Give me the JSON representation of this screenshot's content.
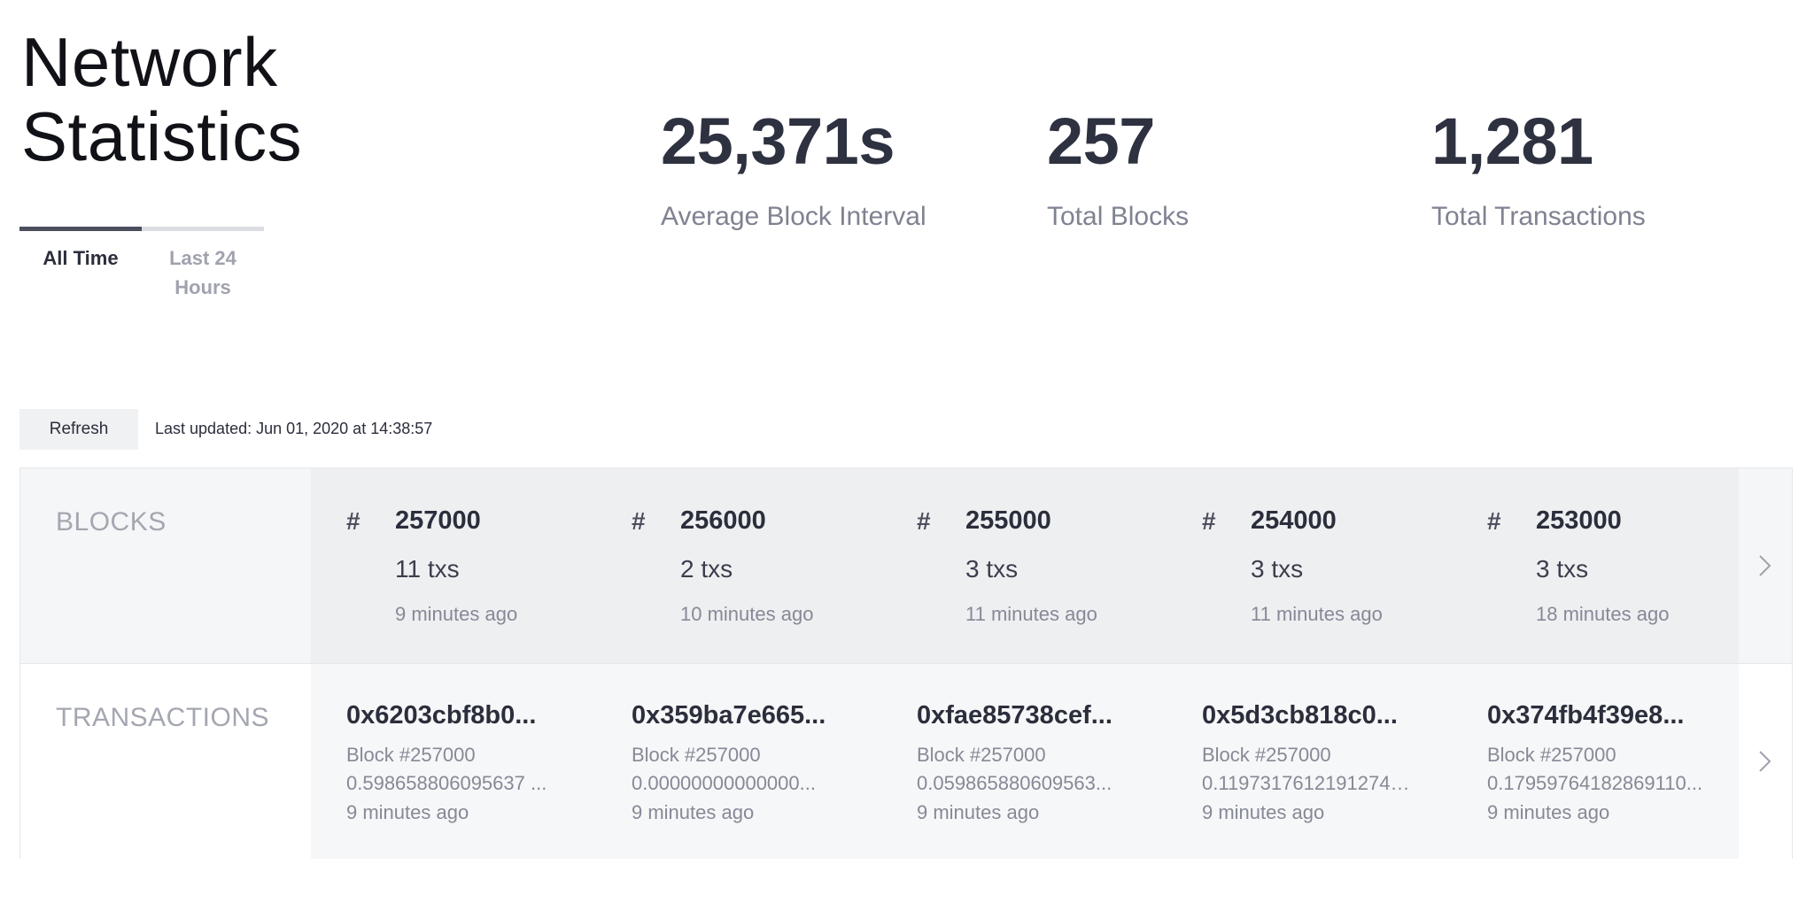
{
  "page": {
    "title_line1": "Network",
    "title_line2": "Statistics"
  },
  "tabs": [
    {
      "label": "All Time",
      "active": true
    },
    {
      "label": "Last 24 Hours",
      "active": false
    }
  ],
  "stats": [
    {
      "value": "25,371s",
      "label": "Average Block Interval"
    },
    {
      "value": "257",
      "label": "Total Blocks"
    },
    {
      "value": "1,281",
      "label": "Total Transactions"
    }
  ],
  "toolbar": {
    "refresh_label": "Refresh",
    "last_updated_prefix": "Last updated:",
    "last_updated_value": "Jun 01, 2020 at 14:38:57"
  },
  "blocks": {
    "label": "BLOCKS",
    "hash_symbol": "#",
    "items": [
      {
        "number": "257000",
        "txs": "11 txs",
        "time": "9 minutes ago"
      },
      {
        "number": "256000",
        "txs": "2 txs",
        "time": "10 minutes ago"
      },
      {
        "number": "255000",
        "txs": "3 txs",
        "time": "11 minutes ago"
      },
      {
        "number": "254000",
        "txs": "3 txs",
        "time": "11 minutes ago"
      },
      {
        "number": "253000",
        "txs": "3 txs",
        "time": "18 minutes ago"
      }
    ]
  },
  "transactions": {
    "label": "TRANSACTIONS",
    "items": [
      {
        "hash": "0x6203cbf8b0...",
        "block": "Block #257000",
        "value": "0.598658806095637 ...",
        "time": "9 minutes ago"
      },
      {
        "hash": "0x359ba7e665...",
        "block": "Block #257000",
        "value": "0.00000000000000...",
        "time": "9 minutes ago"
      },
      {
        "hash": "0xfae85738cef...",
        "block": "Block #257000",
        "value": "0.059865880609563...",
        "time": "9 minutes ago"
      },
      {
        "hash": "0x5d3cb818c0...",
        "block": "Block #257000",
        "value": "0.119731761219127403 ...",
        "time": "9 minutes ago"
      },
      {
        "hash": "0x374fb4f39e8...",
        "block": "Block #257000",
        "value": "0.17959764182869110...",
        "time": "9 minutes ago"
      }
    ]
  },
  "icons": {
    "next_arrow": "chevron-right-icon"
  },
  "colors": {
    "text_dark": "#2b2e3b",
    "text_muted": "#868996",
    "tab_active_bar": "#4b4e5c",
    "panel_bg": "#f5f6f7"
  }
}
